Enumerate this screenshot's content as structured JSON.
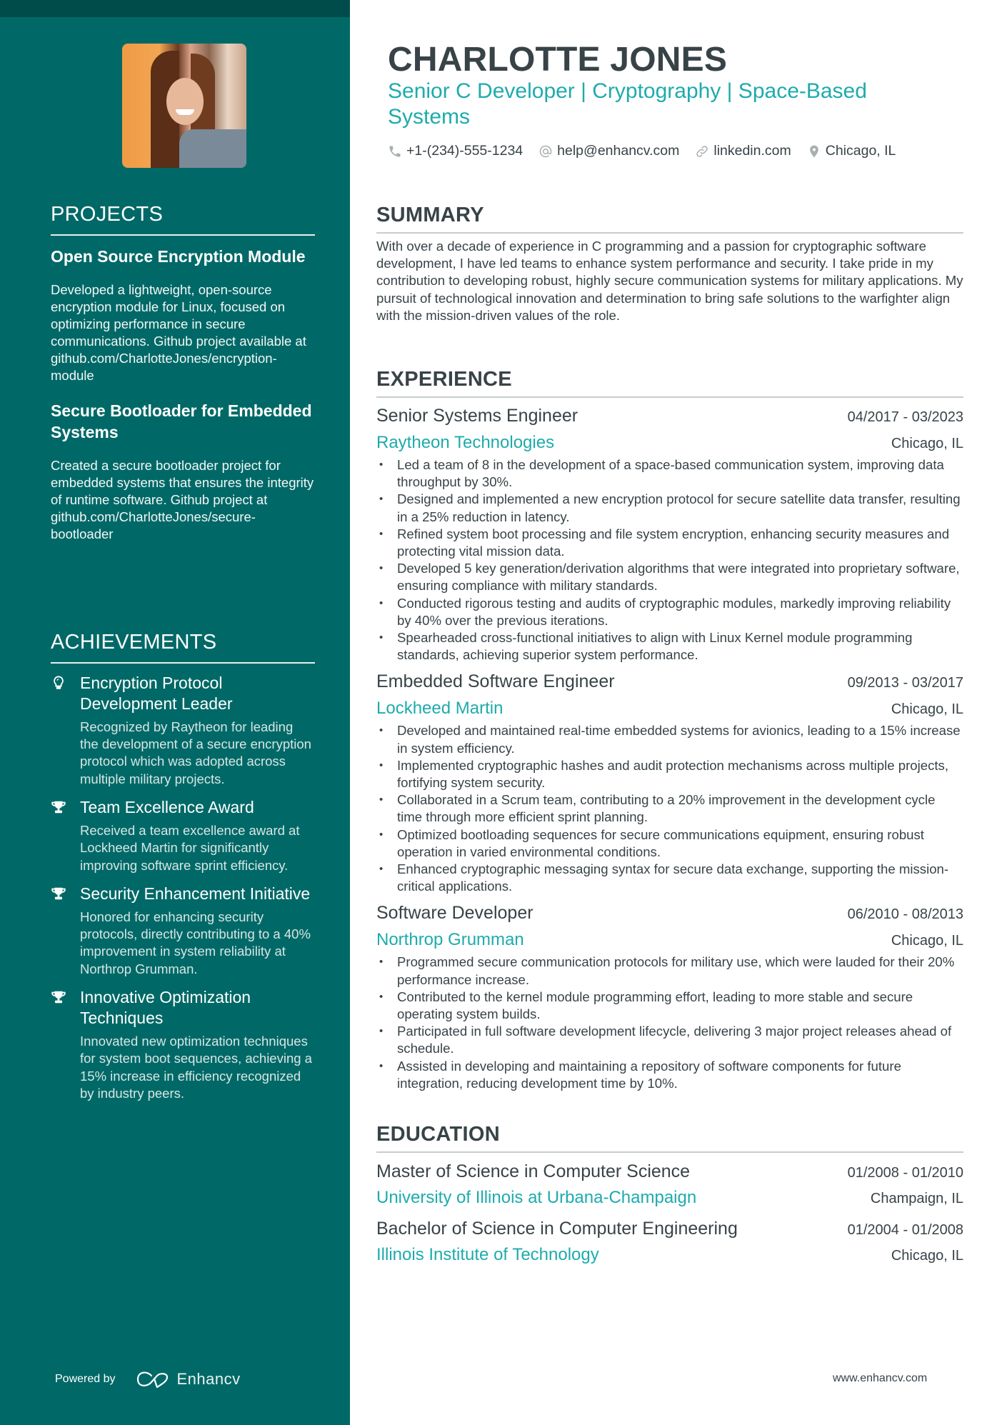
{
  "header": {
    "name": "CHARLOTTE JONES",
    "tagline": "Senior C Developer | Cryptography | Space-Based Systems",
    "contacts": [
      {
        "icon": "phone-icon",
        "text": "+1-(234)-555-1234"
      },
      {
        "icon": "at-icon",
        "text": "help@enhancv.com"
      },
      {
        "icon": "link-icon",
        "text": "linkedin.com"
      },
      {
        "icon": "location-pin-icon",
        "text": "Chicago, IL"
      }
    ]
  },
  "colors": {
    "sidebar": "#006967",
    "sidebar_band": "#004c4b",
    "accent": "#1eabad",
    "text": "#384347"
  },
  "sidebar": {
    "projects": {
      "title": "PROJECTS",
      "items": [
        {
          "title": "Open Source Encryption Module",
          "description": "Developed a lightweight, open-source encryption module for Linux, focused on optimizing performance in secure communications. Github project available at github.com/CharlotteJones/encryption-module"
        },
        {
          "title": "Secure Bootloader for Embedded Systems",
          "description": "Created a secure bootloader project for embedded systems that ensures the integrity of runtime software. Github project at github.com/CharlotteJones/secure-bootloader"
        }
      ]
    },
    "achievements": {
      "title": "ACHIEVEMENTS",
      "items": [
        {
          "icon": "lightbulb-icon",
          "title": "Encryption Protocol Development Leader",
          "description": "Recognized by Raytheon for leading the development of a secure encryption protocol which was adopted across multiple military projects."
        },
        {
          "icon": "trophy-icon",
          "title": "Team Excellence Award",
          "description": "Received a team excellence award at Lockheed Martin for significantly improving software sprint efficiency."
        },
        {
          "icon": "trophy-icon",
          "title": "Security Enhancement Initiative",
          "description": "Honored for enhancing security protocols, directly contributing to a 40% improvement in system reliability at Northrop Grumman."
        },
        {
          "icon": "trophy-icon",
          "title": "Innovative Optimization Techniques",
          "description": "Innovated new optimization techniques for system boot sequences, achieving a 15% increase in efficiency recognized by industry peers."
        }
      ]
    },
    "powered_by": "Powered by",
    "brand": "Enhancv"
  },
  "summary": {
    "title": "SUMMARY",
    "text": "With over a decade of experience in C programming and a passion for cryptographic software development, I have led teams to enhance system performance and security. I take pride in my contribution to developing robust, highly secure communication systems for military applications. My pursuit of technological innovation and determination to bring safe solutions to the warfighter align with the mission-driven values of the role."
  },
  "experience": {
    "title": "EXPERIENCE",
    "jobs": [
      {
        "title": "Senior Systems Engineer",
        "dates": "04/2017 - 03/2023",
        "company": "Raytheon Technologies",
        "location": "Chicago, IL",
        "bullets": [
          "Led a team of 8 in the development of a space-based communication system, improving data throughput by 30%.",
          "Designed and implemented a new encryption protocol for secure satellite data transfer, resulting in a 25% reduction in latency.",
          "Refined system boot processing and file system encryption, enhancing security measures and protecting vital mission data.",
          "Developed 5 key generation/derivation algorithms that were integrated into proprietary software, ensuring compliance with military standards.",
          "Conducted rigorous testing and audits of cryptographic modules, markedly improving reliability by 40% over the previous iterations.",
          "Spearheaded cross-functional initiatives to align with Linux Kernel module programming standards, achieving superior system performance."
        ]
      },
      {
        "title": "Embedded Software Engineer",
        "dates": "09/2013 - 03/2017",
        "company": "Lockheed Martin",
        "location": "Chicago, IL",
        "bullets": [
          "Developed and maintained real-time embedded systems for avionics, leading to a 15% increase in system efficiency.",
          "Implemented cryptographic hashes and audit protection mechanisms across multiple projects, fortifying system security.",
          "Collaborated in a Scrum team, contributing to a 20% improvement in the development cycle time through more efficient sprint planning.",
          "Optimized bootloading sequences for secure communications equipment, ensuring robust operation in varied environmental conditions.",
          "Enhanced cryptographic messaging syntax for secure data exchange, supporting the mission-critical applications."
        ]
      },
      {
        "title": "Software Developer",
        "dates": "06/2010 - 08/2013",
        "company": "Northrop Grumman",
        "location": "Chicago, IL",
        "bullets": [
          "Programmed secure communication protocols for military use, which were lauded for their 20% performance increase.",
          "Contributed to the kernel module programming effort, leading to more stable and secure operating system builds.",
          "Participated in full software development lifecycle, delivering 3 major project releases ahead of schedule.",
          "Assisted in developing and maintaining a repository of software components for future integration, reducing development time by 10%."
        ]
      }
    ]
  },
  "education": {
    "title": "EDUCATION",
    "items": [
      {
        "degree": "Master of Science in Computer Science",
        "dates": "01/2008 - 01/2010",
        "school": "University of Illinois at Urbana-Champaign",
        "location": "Champaign, IL"
      },
      {
        "degree": "Bachelor of Science in Computer Engineering",
        "dates": "01/2004 - 01/2008",
        "school": "Illinois Institute of Technology",
        "location": "Chicago, IL"
      }
    ]
  },
  "footer": {
    "url": "www.enhancv.com"
  }
}
